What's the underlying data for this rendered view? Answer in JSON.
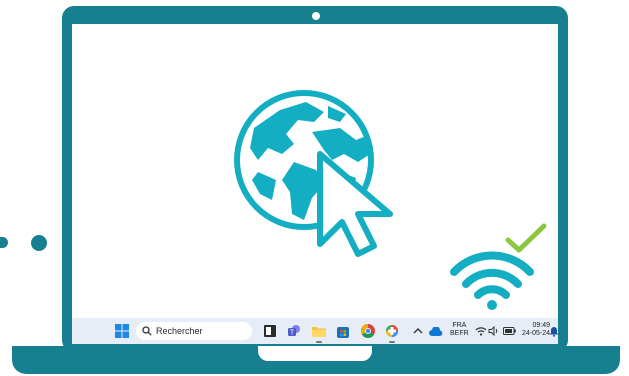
{
  "taskbar": {
    "search_placeholder": "Rechercher",
    "language_line1": "FRA",
    "language_line2": "BEFR",
    "time": "09:49",
    "date": "24-05-24"
  },
  "colors": {
    "frame": "#167f90",
    "globe": "#13aec1",
    "check": "#8cc63f",
    "taskbar": "#e7edf6"
  },
  "icons": {
    "center": [
      "globe-icon",
      "cursor-arrow-icon"
    ],
    "status": [
      "wifi-icon",
      "checkmark-icon"
    ],
    "taskbar": [
      "windows-start-icon",
      "search-icon",
      "widget-icon",
      "teams-icon",
      "file-explorer-icon",
      "store-icon",
      "chrome-icon",
      "copilot-icon",
      "chevron-up-icon",
      "onedrive-icon",
      "wifi-small-icon",
      "volume-icon",
      "battery-icon",
      "notification-bell-icon"
    ]
  }
}
